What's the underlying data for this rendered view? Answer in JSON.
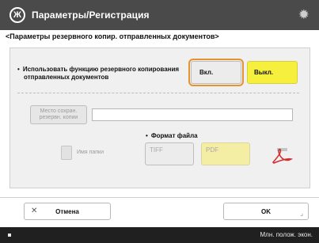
{
  "header": {
    "title": "Параметры/Регистрация",
    "app_icon": "Ж",
    "settings_icon": "gear-icon"
  },
  "breadcrumb": "<Параметры резервного копир. отправленных документов>",
  "function": {
    "label_line1": "Использовать функцию резервного копирования",
    "label_line2": "отправленных документов",
    "on_label": "Вкл.",
    "off_label": "Выкл."
  },
  "location": {
    "button_label_line1": "Место сохран.",
    "button_label_line2": "резервн. копии",
    "value": ""
  },
  "file_format": {
    "label": "Формат файла",
    "tiff_label": "TIFF",
    "pdf_label": "PDF",
    "name_label": "Имя папки"
  },
  "footer": {
    "cancel_label": "Отмена",
    "ok_label": "OK"
  },
  "status": {
    "text": "Млн. полож. экон."
  },
  "colors": {
    "title_bar": "#4a4a4a",
    "selected_yellow": "#f6ef3d",
    "focus_orange": "#e6922f"
  }
}
